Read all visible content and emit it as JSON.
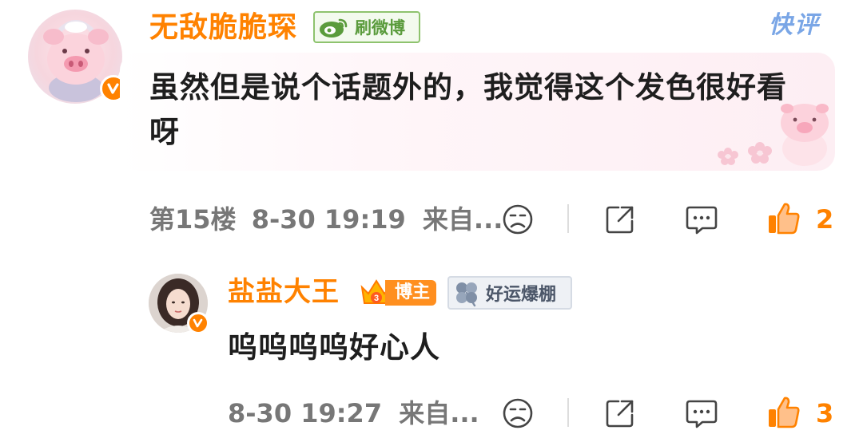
{
  "comment": {
    "username": "无敌脆脆琛",
    "badge_label": "刷微博",
    "quick_review_label": "快评",
    "text": "虽然但是说个话题外的，我觉得这个发色很好看呀",
    "floor": "第15楼",
    "time": "8-30 19:19",
    "source": "来自...",
    "like_count": "2",
    "avatar_icon": "pig-avatar",
    "verified_icon": "verified-v-icon"
  },
  "reply": {
    "username": "盐盐大王",
    "rank_badge_label": "博主",
    "rank_level": "3",
    "fan_badge_label": "好运爆棚",
    "text": "呜呜呜呜好心人",
    "time": "8-30 19:27",
    "source": "来自...",
    "like_count": "3",
    "avatar_icon": "woman-avatar",
    "verified_icon": "verified-v-icon"
  },
  "colors": {
    "accent": "#ff8200",
    "text": "#1e1e1e",
    "meta": "#777777",
    "weibo_green": "#5a9b3c",
    "bubble_pink": "#fdeef3"
  }
}
